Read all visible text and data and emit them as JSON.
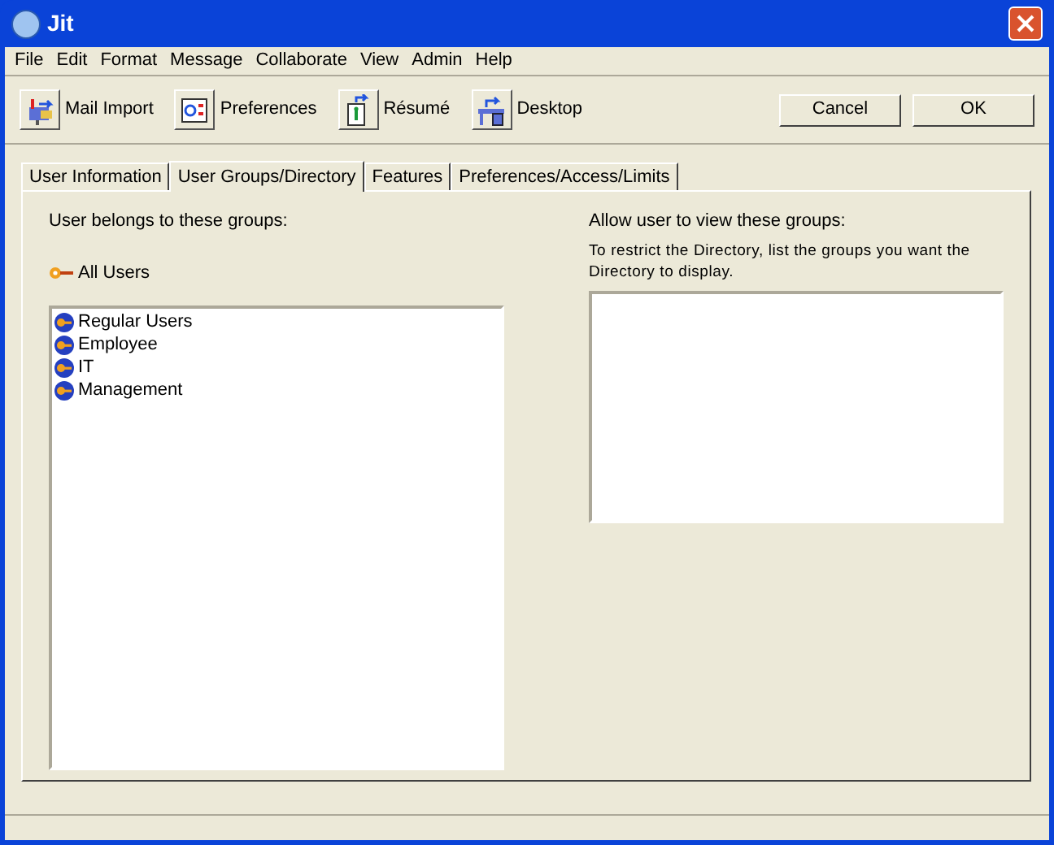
{
  "window": {
    "title": "Jit"
  },
  "menu": [
    "File",
    "Edit",
    "Format",
    "Message",
    "Collaborate",
    "View",
    "Admin",
    "Help"
  ],
  "toolbar": [
    {
      "label": "Mail Import",
      "kind": "mail"
    },
    {
      "label": "Preferences",
      "kind": "prefs"
    },
    {
      "label": "Résumé",
      "kind": "resume"
    },
    {
      "label": "Desktop",
      "kind": "desktop"
    }
  ],
  "dialog_buttons": [
    "Cancel",
    "OK"
  ],
  "tabs": [
    {
      "label": "User Information",
      "selected": false
    },
    {
      "label": "User Groups/Directory",
      "selected": true
    },
    {
      "label": "Features",
      "selected": false
    },
    {
      "label": "Preferences/Access/Limits",
      "selected": false
    }
  ],
  "groups": {
    "heading": "User belongs to these groups:",
    "default_group": "All Users",
    "items": [
      "Regular Users",
      "Employee",
      "IT",
      "Management"
    ]
  },
  "directory": {
    "heading": "Allow user to view these groups:",
    "hint": "To restrict the Directory, list the groups you want the Directory to display."
  }
}
